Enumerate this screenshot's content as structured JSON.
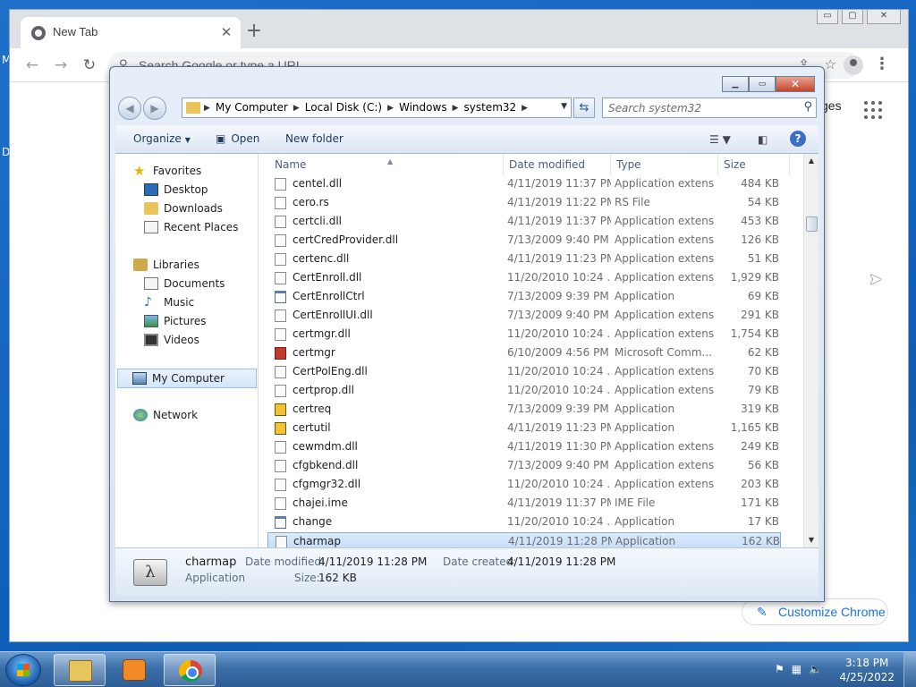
{
  "desktop": {
    "fragment_m": "M",
    "fragment_d": "D"
  },
  "chrome": {
    "tab_title": "New Tab",
    "tab_close": "✕",
    "new_tab": "+",
    "omnibox_placeholder": "Search Google or type a URL",
    "images_link": "ges",
    "customize_label": "Customize Chrome",
    "window_buttons": {
      "min": "▭",
      "max": "▢",
      "close": "✕"
    }
  },
  "explorer": {
    "breadcrumb": [
      "My Computer",
      "Local Disk (C:)",
      "Windows",
      "system32"
    ],
    "search_placeholder": "Search system32",
    "commands": {
      "organize": "Organize",
      "open": "Open",
      "new_folder": "New folder"
    },
    "nav": {
      "favorites": "Favorites",
      "desktop": "Desktop",
      "downloads": "Downloads",
      "recent": "Recent Places",
      "libraries": "Libraries",
      "documents": "Documents",
      "music": "Music",
      "pictures": "Pictures",
      "videos": "Videos",
      "computer": "My Computer",
      "network": "Network"
    },
    "columns": {
      "name": "Name",
      "date": "Date modified",
      "type": "Type",
      "size": "Size"
    },
    "files": [
      {
        "name": "centel.dll",
        "date": "4/11/2019 11:37 PM",
        "type": "Application extens...",
        "size": "484 KB",
        "icon": "dll"
      },
      {
        "name": "cero.rs",
        "date": "4/11/2019 11:22 PM",
        "type": "RS File",
        "size": "54 KB",
        "icon": "file"
      },
      {
        "name": "certcli.dll",
        "date": "4/11/2019 11:37 PM",
        "type": "Application extens...",
        "size": "453 KB",
        "icon": "dll"
      },
      {
        "name": "certCredProvider.dll",
        "date": "7/13/2009 9:40 PM",
        "type": "Application extens...",
        "size": "126 KB",
        "icon": "dll"
      },
      {
        "name": "certenc.dll",
        "date": "4/11/2019 11:23 PM",
        "type": "Application extens...",
        "size": "51 KB",
        "icon": "dll"
      },
      {
        "name": "CertEnroll.dll",
        "date": "11/20/2010 10:24 ...",
        "type": "Application extens...",
        "size": "1,929 KB",
        "icon": "dll"
      },
      {
        "name": "CertEnrollCtrl",
        "date": "7/13/2009 9:39 PM",
        "type": "Application",
        "size": "69 KB",
        "icon": "app"
      },
      {
        "name": "CertEnrollUI.dll",
        "date": "7/13/2009 9:40 PM",
        "type": "Application extens...",
        "size": "291 KB",
        "icon": "dll"
      },
      {
        "name": "certmgr.dll",
        "date": "11/20/2010 10:24 ...",
        "type": "Application extens...",
        "size": "1,754 KB",
        "icon": "dll"
      },
      {
        "name": "certmgr",
        "date": "6/10/2009 4:56 PM",
        "type": "Microsoft Comm...",
        "size": "62 KB",
        "icon": "msc"
      },
      {
        "name": "CertPolEng.dll",
        "date": "11/20/2010 10:24 ...",
        "type": "Application extens...",
        "size": "70 KB",
        "icon": "dll"
      },
      {
        "name": "certprop.dll",
        "date": "11/20/2010 10:24 ...",
        "type": "Application extens...",
        "size": "79 KB",
        "icon": "dll"
      },
      {
        "name": "certreq",
        "date": "7/13/2009 9:39 PM",
        "type": "Application",
        "size": "319 KB",
        "icon": "cert"
      },
      {
        "name": "certutil",
        "date": "4/11/2019 11:23 PM",
        "type": "Application",
        "size": "1,165 KB",
        "icon": "cert"
      },
      {
        "name": "cewmdm.dll",
        "date": "4/11/2019 11:30 PM",
        "type": "Application extens...",
        "size": "249 KB",
        "icon": "dll"
      },
      {
        "name": "cfgbkend.dll",
        "date": "7/13/2009 9:40 PM",
        "type": "Application extens...",
        "size": "56 KB",
        "icon": "dll"
      },
      {
        "name": "cfgmgr32.dll",
        "date": "11/20/2010 10:24 ...",
        "type": "Application extens...",
        "size": "203 KB",
        "icon": "dll"
      },
      {
        "name": "chajei.ime",
        "date": "4/11/2019 11:37 PM",
        "type": "IME File",
        "size": "171 KB",
        "icon": "file"
      },
      {
        "name": "change",
        "date": "11/20/2010 10:24 ...",
        "type": "Application",
        "size": "17 KB",
        "icon": "app"
      },
      {
        "name": "charmap",
        "date": "4/11/2019 11:28 PM",
        "type": "Application",
        "size": "162 KB",
        "icon": "dll",
        "selected": true
      }
    ],
    "details": {
      "name": "charmap",
      "kind": "Application",
      "modified_label": "Date modified:",
      "modified_value": "4/11/2019 11:28 PM",
      "created_label": "Date created:",
      "created_value": "4/11/2019 11:28 PM",
      "size_label": "Size:",
      "size_value": "162 KB"
    }
  },
  "taskbar": {
    "time": "3:18 PM",
    "date": "4/25/2022"
  }
}
